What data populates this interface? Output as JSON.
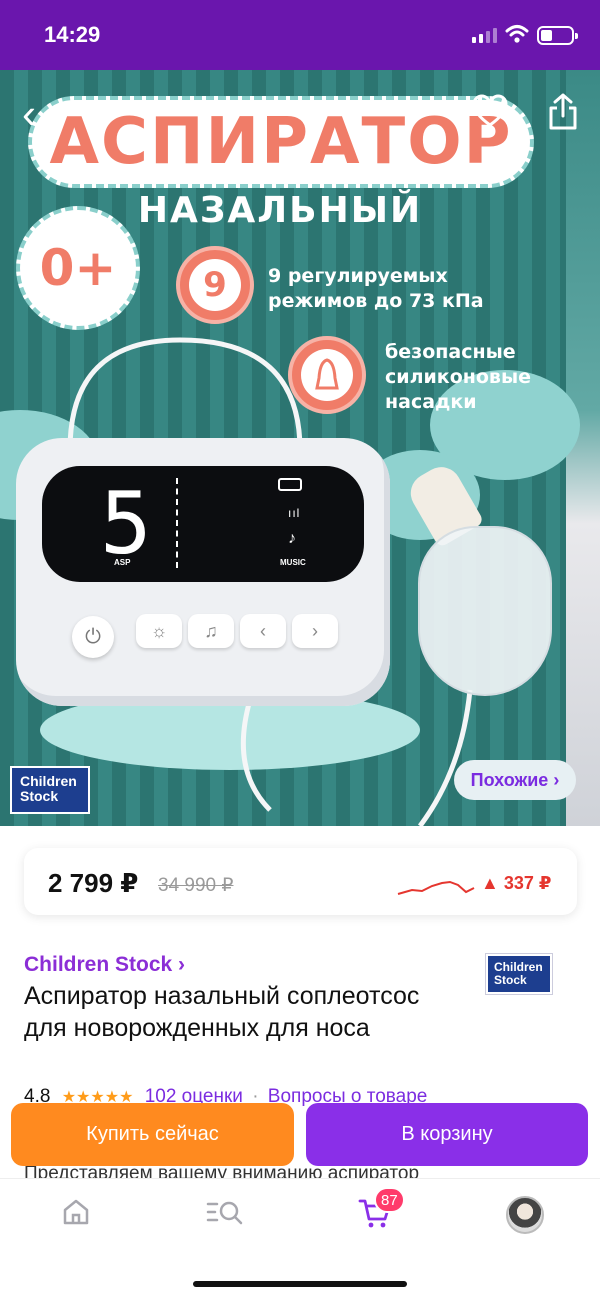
{
  "status_bar": {
    "time": "14:29"
  },
  "hero": {
    "title": "АСПИРАТОР",
    "subtitle": "НАЗАЛЬНЫЙ",
    "age_badge": "0+",
    "feature1_number": "9",
    "feature1_line1": "9 регулируемых",
    "feature1_line2": "режимов до 73 кПа",
    "feature2_line1": "безопасные",
    "feature2_line2": "силиконовые",
    "feature2_line3": "насадки",
    "device_digit": "5",
    "device_asp_label": "ASP",
    "device_music_label": "MUSIC",
    "brand_logo_line1": "Children",
    "brand_logo_line2": "Stock",
    "similar_button": "Похожие ›"
  },
  "price": {
    "current": "2 799 ₽",
    "old": "34 990 ₽",
    "change": "▲ 337 ₽",
    "change_color": "#e5362f"
  },
  "product": {
    "seller": "Children Stock ›",
    "seller_logo_line1": "Children",
    "seller_logo_line2": "Stock",
    "title": "Аспиратор назальный соплеотсос для новорожденных для носа",
    "rating": "4.8",
    "stars": "★★★★★",
    "reviews": "102 оценки",
    "separator": "·",
    "questions": "Вопросы о товаре",
    "description_start": "Представляем вашему вниманию аспиратор"
  },
  "actions": {
    "buy_now": "Купить сейчас",
    "add_to_cart": "В корзину"
  },
  "tabbar": {
    "cart_count": "87",
    "tabs": [
      "home-icon",
      "catalog-search-icon",
      "cart-icon",
      "profile-avatar"
    ]
  },
  "colors": {
    "brand_purple": "#6a16ad",
    "accent_orange": "#ff8a1f",
    "accent_violet": "#8a2fe8"
  }
}
